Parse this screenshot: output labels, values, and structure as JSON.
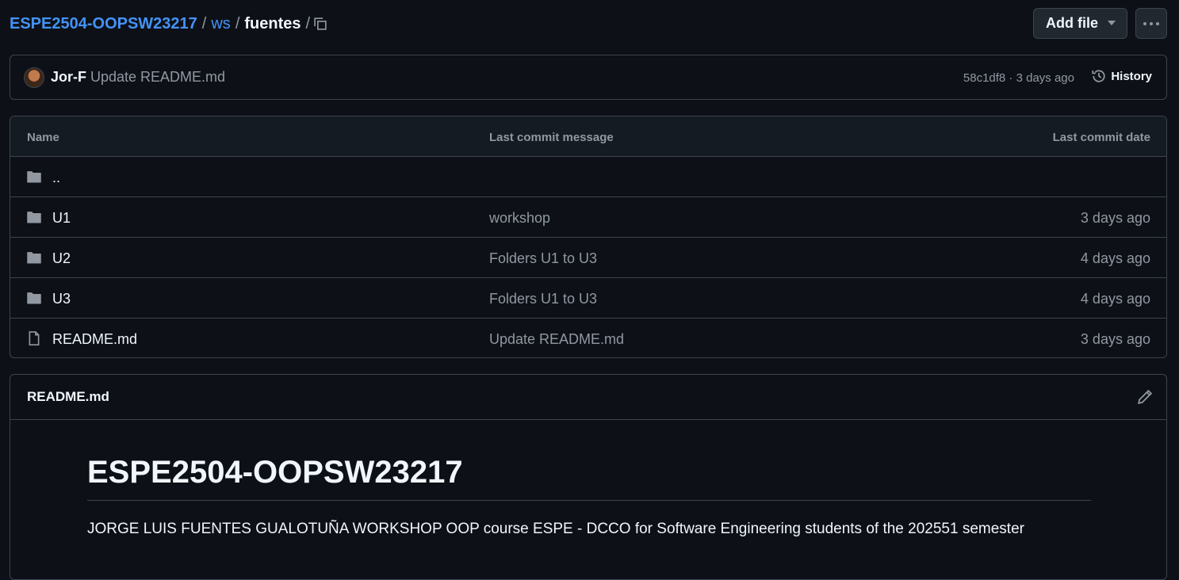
{
  "breadcrumb": {
    "repo": "ESPE2504-OOPSW23217",
    "folder1": "ws",
    "current": "fuentes",
    "sep1": "/",
    "sep2": "/",
    "sep3": "/"
  },
  "toolbar": {
    "add_file_label": "Add file",
    "more_icon": "kebab-horizontal-icon",
    "copy_icon": "copy-icon"
  },
  "latest_commit": {
    "author": "Jor-F",
    "message": "Update README.md",
    "meta": "58c1df8 · 3 days ago",
    "history_label": "History"
  },
  "files": {
    "columns": {
      "name": "Name",
      "message": "Last commit message",
      "date": "Last commit date"
    },
    "rows": [
      {
        "name": "..",
        "message": "",
        "date": "",
        "icon": "folder-icon"
      },
      {
        "name": "U1",
        "message": "workshop",
        "date": "3 days ago",
        "icon": "folder-icon"
      },
      {
        "name": "U2",
        "message": "Folders U1 to U3",
        "date": "4 days ago",
        "icon": "folder-icon"
      },
      {
        "name": "U3",
        "message": "Folders U1 to U3",
        "date": "4 days ago",
        "icon": "folder-icon"
      },
      {
        "name": "README.md",
        "message": "Update README.md",
        "date": "3 days ago",
        "icon": "file-icon"
      }
    ]
  },
  "readme": {
    "title": "README.md",
    "heading": "ESPE2504-OOPSW23217",
    "paragraph": "JORGE LUIS FUENTES GUALOTUÑA WORKSHOP OOP course ESPE - DCCO for Software Engineering students of the 202551 semester"
  },
  "colors": {
    "background": "#0d1117",
    "border": "#3d444d",
    "link": "#4493f8",
    "muted": "#9198a1",
    "text": "#f0f6fc"
  }
}
